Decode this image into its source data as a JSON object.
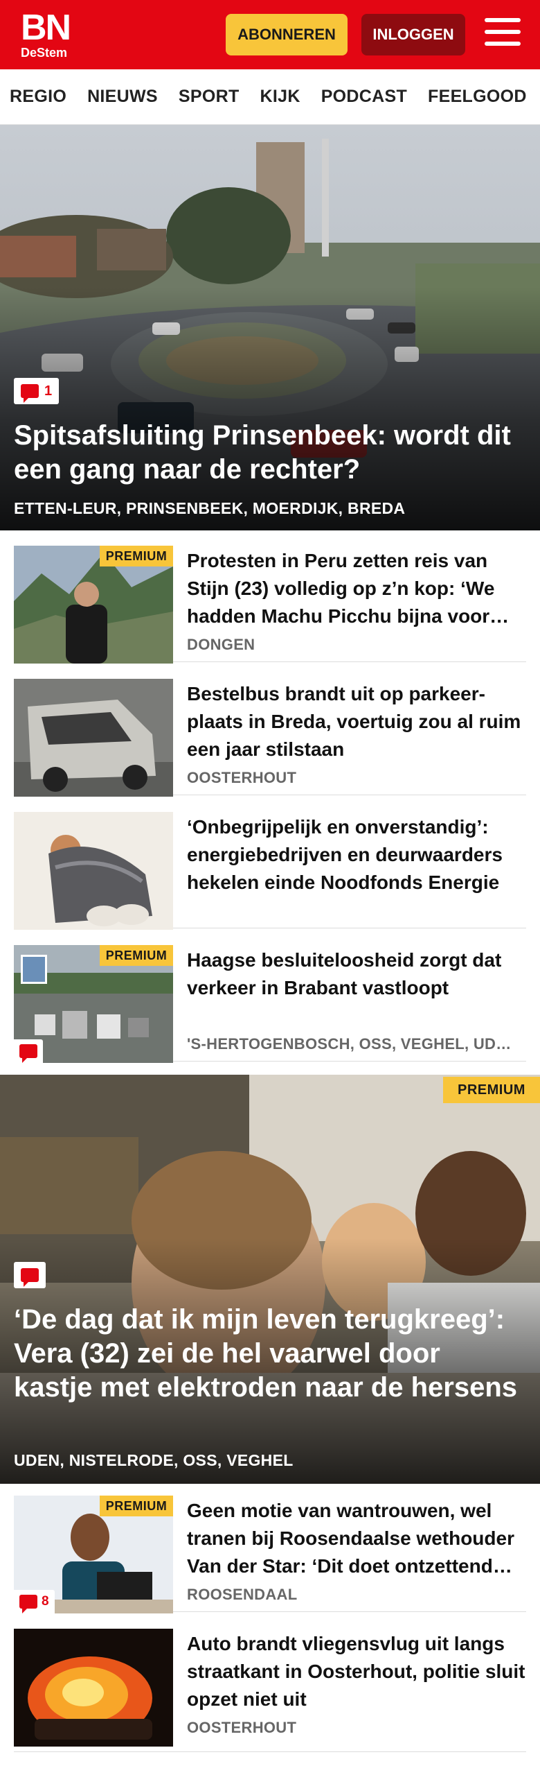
{
  "header": {
    "logo_main": "BN",
    "logo_sub": "DeStem",
    "subscribe_label": "ABONNEREN",
    "login_label": "INLOGGEN",
    "brand_color": "#e30613",
    "accent_color": "#f8c53a"
  },
  "nav": {
    "items": [
      "REGIO",
      "NIEUWS",
      "SPORT",
      "KIJK",
      "PODCAST",
      "FEELGOOD"
    ]
  },
  "hero1": {
    "comment_count": "1",
    "title": "Spitsafsluiting Prinsenbeek: wordt dit een gang naar de rechter?",
    "locations": "ETTEN-LEUR, PRINSENBEEK, MOERDIJK, BREDA"
  },
  "articles1": [
    {
      "premium": "PREMIUM",
      "headline": "Protesten in Peru zetten reis van Stijn (23) volledig op z’n kop: ‘We hadden Machu Picchu bijna voor ons alleen’",
      "place": "DONGEN"
    },
    {
      "headline": "Bestelbus brandt uit op parkeer­plaats in Breda, voertuig zou al ruim een jaar stilstaan",
      "place": "OOSTERHOUT"
    },
    {
      "headline": "‘Onbegrijpelijk en onverstandig’: energiebedrijven en deurwaar­ders hekelen einde Noodfonds Energie",
      "place": ""
    },
    {
      "premium": "PREMIUM",
      "headline": "Haagse besluiteloosheid zorgt dat verkeer in Brabant vastloopt",
      "place": "'S-HERTOGENBOSCH, OSS, VEGHEL, UDEN"
    }
  ],
  "hero2": {
    "premium": "PREMIUM",
    "title": "‘De dag dat ik mijn leven terugkreeg’: Vera (32) zei de hel vaarwel door kastje met elektroden naar de hersens",
    "locations": "UDEN, NISTELRODE, OSS, VEGHEL"
  },
  "articles2": [
    {
      "premium": "PREMIUM",
      "comment_count": "8",
      "headline": "Geen motie van wantrouwen, wel tranen bij Roosendaalse wethouder Van der Star: ‘Dit doet ontzettend veel pijn’",
      "place": "ROOSENDAAL"
    },
    {
      "headline": "Auto brandt vliegensvlug uit langs straatkant in Oosterhout, politie sluit opzet niet uit",
      "place": "OOSTERHOUT"
    }
  ]
}
